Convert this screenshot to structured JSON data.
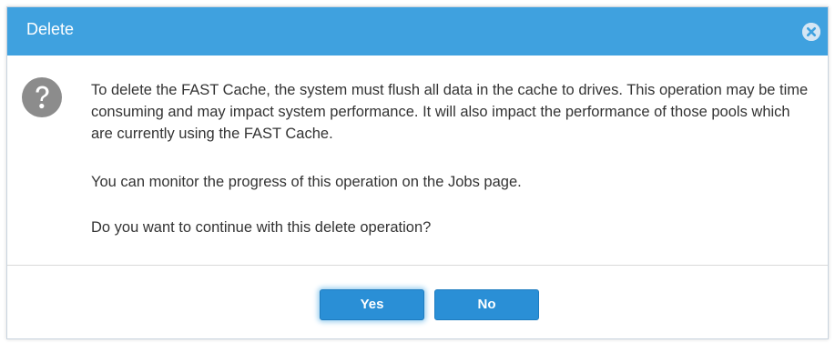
{
  "dialog": {
    "title": "Delete",
    "close_icon": "close-icon",
    "question_icon": "question-icon",
    "message_1": "To delete the FAST Cache, the system must flush all data in the cache to drives. This operation may be time consuming and may impact system performance. It will also impact the performance of those pools which are currently using the FAST Cache.",
    "message_2": "You can monitor the progress of this operation on the Jobs page.",
    "message_3": "Do you want to continue with this delete operation?",
    "yes_label": "Yes",
    "no_label": "No"
  },
  "colors": {
    "titlebar": "#3fa1df",
    "button": "#2a8fd6",
    "text": "#333333"
  }
}
